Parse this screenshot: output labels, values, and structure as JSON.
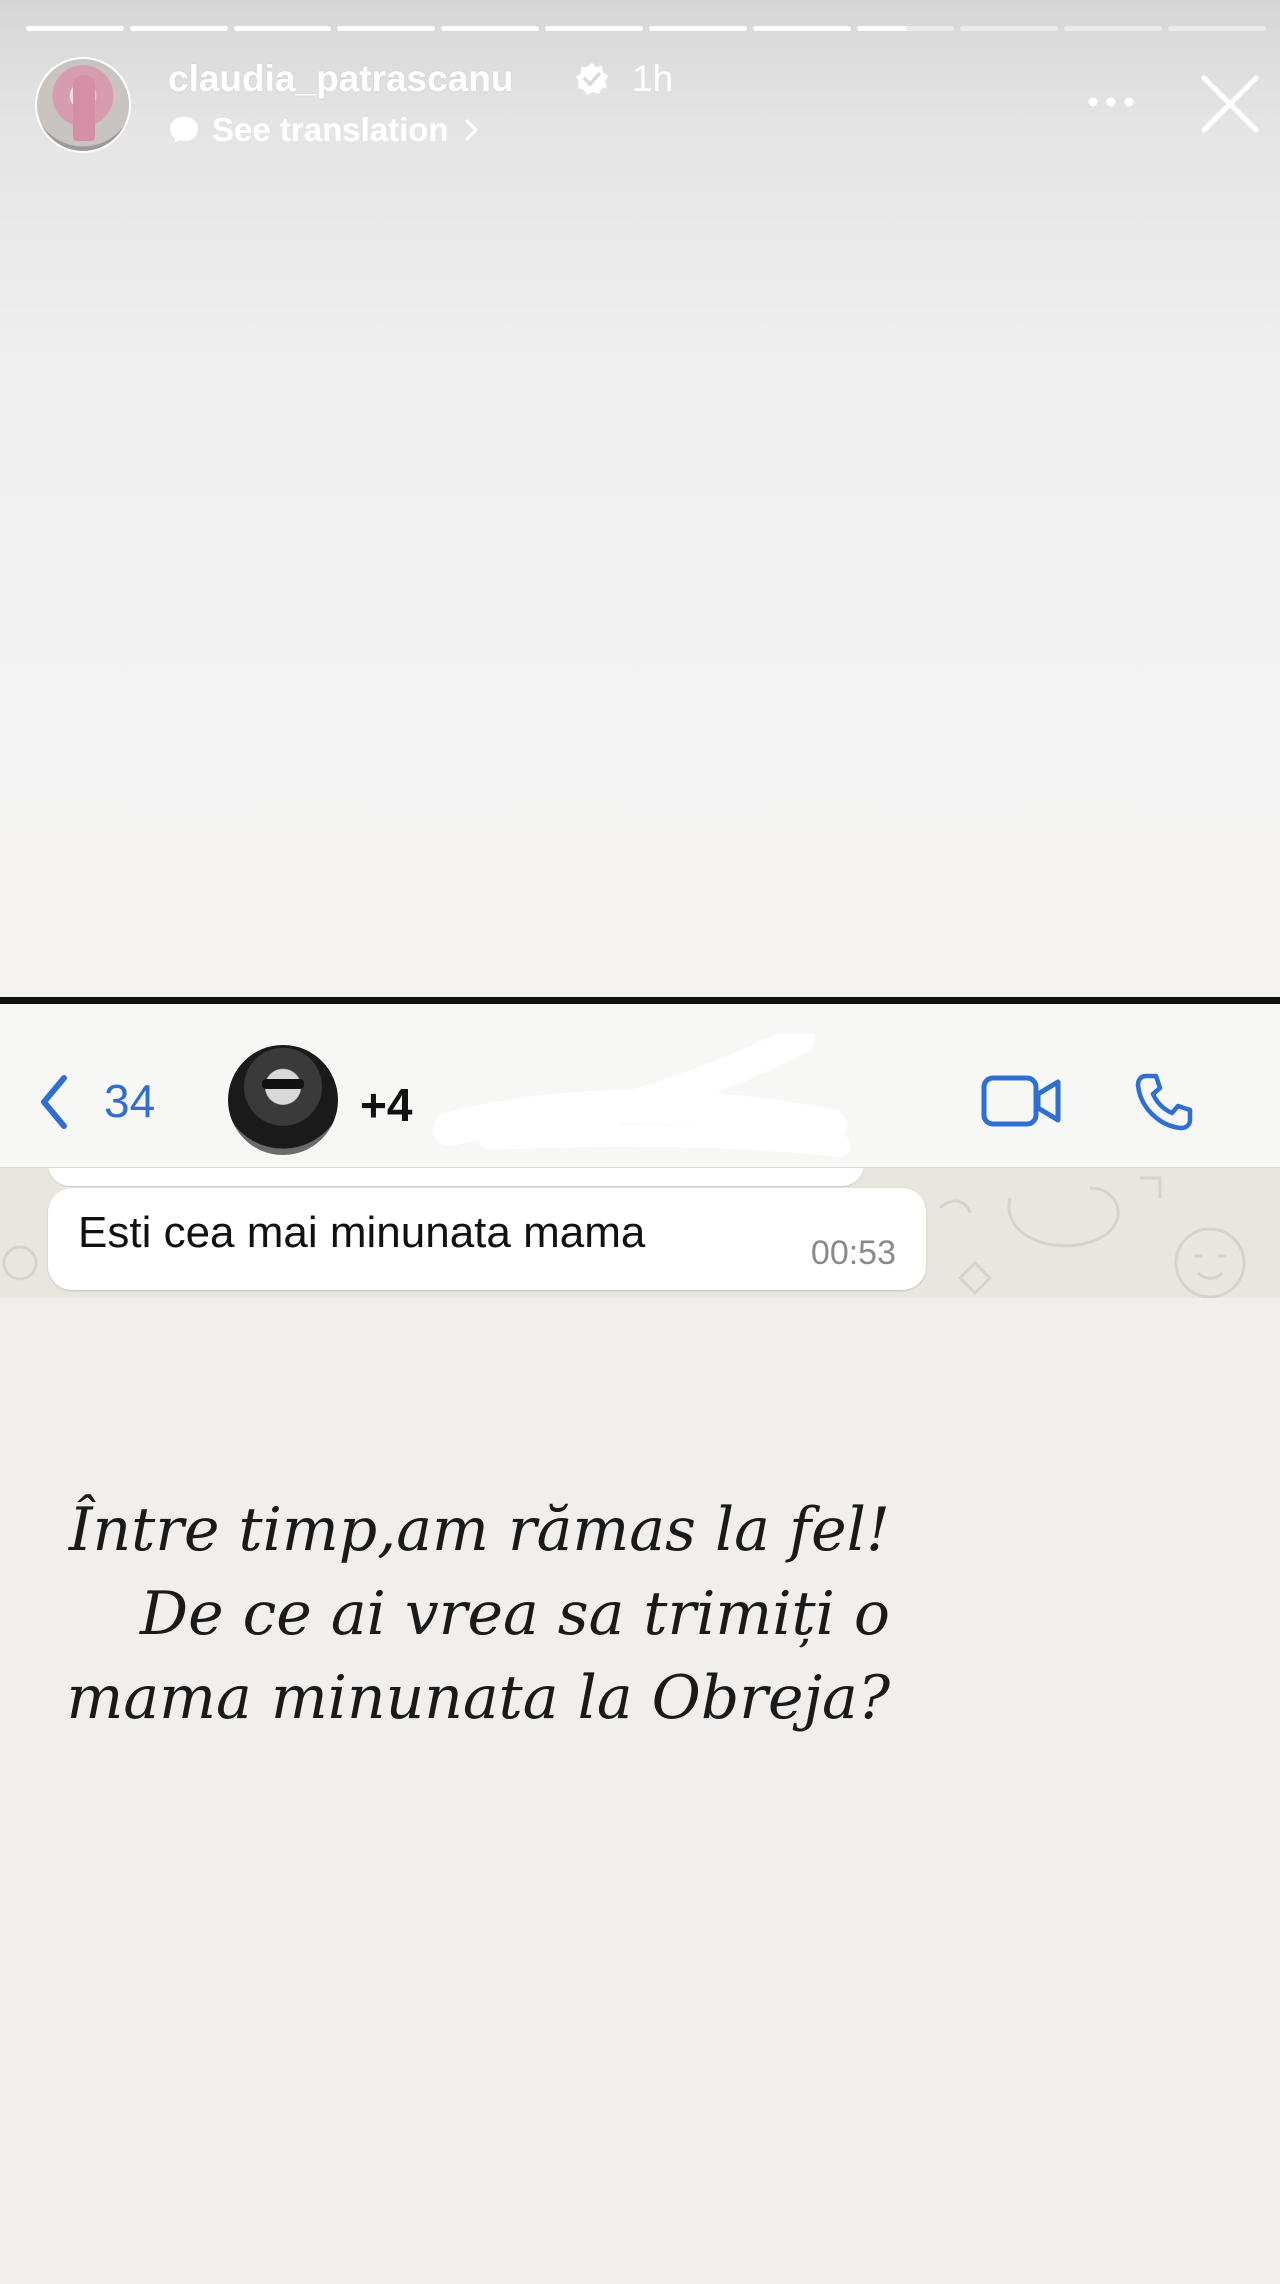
{
  "story": {
    "username": "claudia_patrascanu",
    "verified": true,
    "time_ago": "1h",
    "translate_label": "See translation",
    "progress": {
      "segments": 12,
      "completed_segments": 8,
      "current_segment_fraction": 0.5
    },
    "icons": {
      "more": "more-horizontal-icon",
      "close": "close-icon",
      "translate": "speech-bubble-icon",
      "verified": "verified-badge-icon"
    }
  },
  "whatsapp": {
    "back_count": "34",
    "contact_name": "+4",
    "icons": {
      "back": "chevron-left-icon",
      "video": "video-call-icon",
      "call": "phone-icon"
    },
    "accent_color": "#2e6fd0",
    "messages": [
      {
        "text": "Esti cea mai minunata mama",
        "time": "00:53"
      }
    ]
  },
  "caption": {
    "lines": [
      "Între timp,am rămas la fel!",
      "De ce ai vrea sa trimiți o",
      "mama minunata la  Obreja?"
    ]
  }
}
